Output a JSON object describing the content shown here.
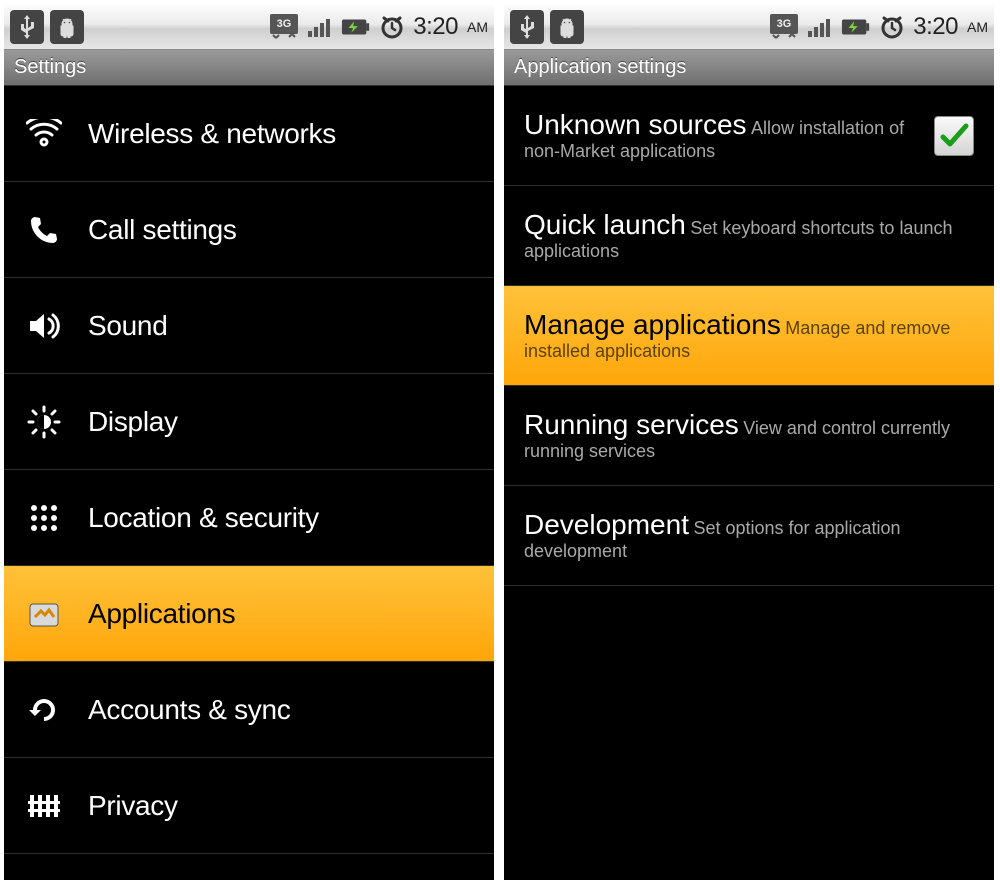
{
  "statusbar": {
    "time": "3:20",
    "ampm": "AM",
    "icons": {
      "usb": "usb",
      "adb": "android-debug",
      "network": "3G",
      "signal": "signal-bars",
      "battery": "battery-charging",
      "alarm": "alarm-clock"
    }
  },
  "screen_left": {
    "title": "Settings",
    "items": [
      {
        "label": "Wireless & networks"
      },
      {
        "label": "Call settings"
      },
      {
        "label": "Sound"
      },
      {
        "label": "Display"
      },
      {
        "label": "Location & security"
      },
      {
        "label": "Applications",
        "selected": true
      },
      {
        "label": "Accounts & sync"
      },
      {
        "label": "Privacy"
      }
    ]
  },
  "screen_right": {
    "title": "Application settings",
    "items": [
      {
        "title": "Unknown sources",
        "sub": "Allow installation of non-Market applications",
        "checkbox": true,
        "checked": true
      },
      {
        "title": "Quick launch",
        "sub": "Set keyboard shortcuts to launch applications"
      },
      {
        "title": "Manage applications",
        "sub": "Manage and remove installed applications",
        "selected": true
      },
      {
        "title": "Running services",
        "sub": "View and control currently running services"
      },
      {
        "title": "Development",
        "sub": "Set options for application development"
      }
    ]
  }
}
